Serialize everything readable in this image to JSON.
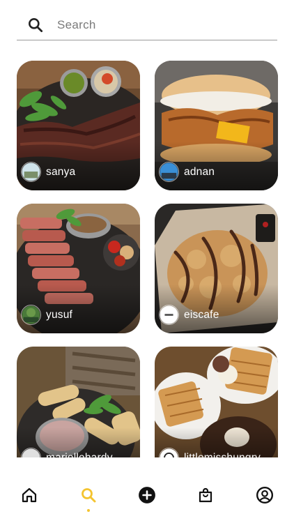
{
  "search": {
    "placeholder": "Search"
  },
  "feed": [
    {
      "username": "sanya"
    },
    {
      "username": "adnan"
    },
    {
      "username": "yusuf"
    },
    {
      "username": "eiscafe"
    },
    {
      "username": "mariellehardy"
    },
    {
      "username": "littlemisshungry"
    }
  ],
  "nav": {
    "items": [
      {
        "icon": "home-icon"
      },
      {
        "icon": "search-icon",
        "active": true
      },
      {
        "icon": "add-icon"
      },
      {
        "icon": "shopping-bag-icon"
      },
      {
        "icon": "profile-icon"
      }
    ],
    "active_color": "#f4c430"
  }
}
